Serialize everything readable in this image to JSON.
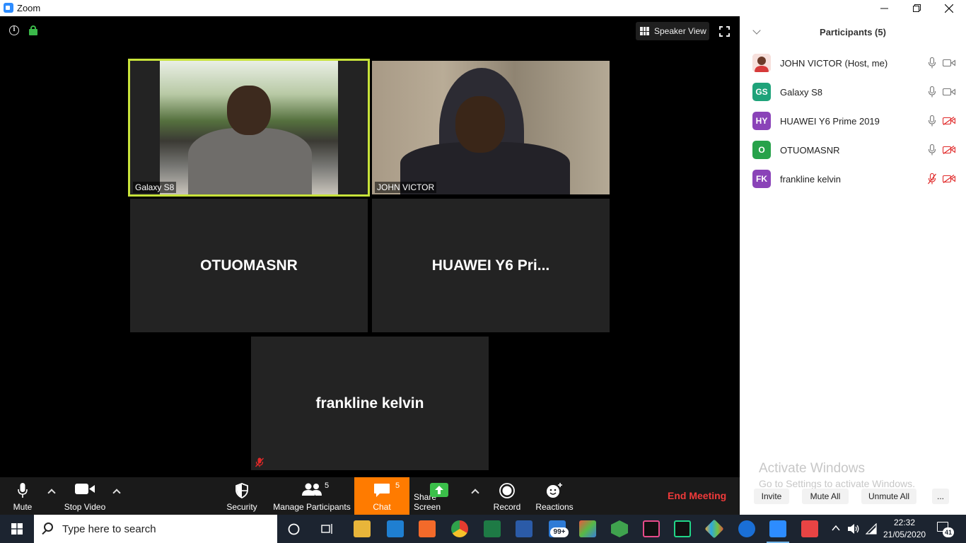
{
  "window": {
    "title": "Zoom"
  },
  "meeting": {
    "view_mode_label": "Speaker View",
    "tiles": [
      {
        "label": "Galaxy S8",
        "has_video": true,
        "active_speaker": true
      },
      {
        "label": "JOHN VICTOR",
        "has_video": true,
        "active_speaker": false
      },
      {
        "label": "OTUOMASNR",
        "has_video": false,
        "active_speaker": false
      },
      {
        "label": "HUAWEI Y6 Pri...",
        "has_video": false,
        "active_speaker": false
      },
      {
        "label": "frankline kelvin",
        "has_video": false,
        "active_speaker": false,
        "muted": true
      }
    ]
  },
  "toolbar": {
    "mute_label": "Mute",
    "stop_video_label": "Stop Video",
    "security_label": "Security",
    "manage_participants_label": "Manage Participants",
    "participants_count": "5",
    "chat_label": "Chat",
    "chat_count": "5",
    "share_screen_label": "Share Screen",
    "record_label": "Record",
    "reactions_label": "Reactions",
    "end_meeting_label": "End Meeting"
  },
  "participants_panel": {
    "title": "Participants (5)",
    "participants": [
      {
        "name": "JOHN VICTOR (Host, me)",
        "initials": "",
        "avatar_color": "#f3c6c6",
        "mic_muted": false,
        "video_off": false
      },
      {
        "name": "Galaxy S8",
        "initials": "GS",
        "avatar_color": "#1fa37a",
        "mic_muted": false,
        "video_off": false
      },
      {
        "name": "HUAWEI Y6 Prime 2019",
        "initials": "HY",
        "avatar_color": "#8a43b8",
        "mic_muted": false,
        "video_off": true
      },
      {
        "name": "OTUOMASNR",
        "initials": "O",
        "avatar_color": "#27a24a",
        "mic_muted": false,
        "video_off": true
      },
      {
        "name": "frankline kelvin",
        "initials": "FK",
        "avatar_color": "#8a43b8",
        "mic_muted": true,
        "video_off": true
      }
    ],
    "watermark_title": "Activate Windows",
    "watermark_sub": "Go to Settings to activate Windows.",
    "invite_label": "Invite",
    "mute_all_label": "Mute All",
    "unmute_all_label": "Unmute All",
    "more_label": "..."
  },
  "taskbar": {
    "search_placeholder": "Type here to search",
    "mail_badge": "99+",
    "time": "22:32",
    "date": "21/05/2020",
    "notification_count": "41"
  },
  "colors": {
    "accent_zoom": "#2d8cff",
    "chat_highlight": "#ff7b00",
    "end_meeting": "#f03a3a",
    "active_speaker_border": "#c8e33a",
    "muted_red": "#e02828"
  }
}
